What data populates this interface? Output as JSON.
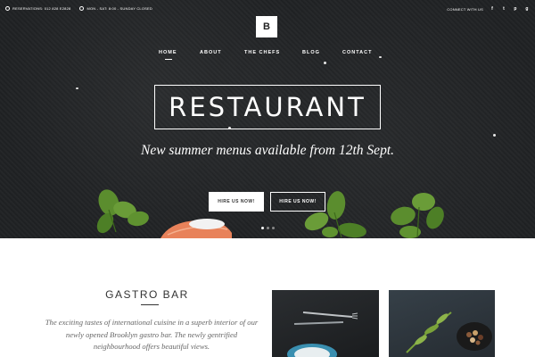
{
  "topbar": {
    "reservations": "RESERVATIONS: 012 828 E2828",
    "hours": "MON - SAT: 8:00 - SUNDAY CLOSED",
    "connect": "CONNECT WITH US",
    "social": [
      "f",
      "t",
      "p",
      "g"
    ]
  },
  "logo": {
    "letter": "B"
  },
  "nav": {
    "items": [
      "HOME",
      "ABOUT",
      "THE CHEFS",
      "BLOG",
      "CONTACT"
    ],
    "active": "HOME"
  },
  "hero": {
    "title": "RESTAURANT",
    "tagline": "New summer menus available from 12th Sept.",
    "buttons": [
      "HIRE US NOW!",
      "HIRE US NOW!"
    ],
    "slide_count": 3,
    "active_slide": 1
  },
  "section": {
    "title": "GASTRO BAR",
    "body": "The exciting tastes of international cuisine in a superb interior of our newly opened Brooklyn gastro bar. The newly gentrified neighbourhood offers beautiful views."
  },
  "colors": {
    "hero_background": "#222426",
    "text_light": "#ffffff",
    "text_dark": "#333333",
    "basil": "#5b8d2e",
    "salmon": "#e8825a"
  }
}
